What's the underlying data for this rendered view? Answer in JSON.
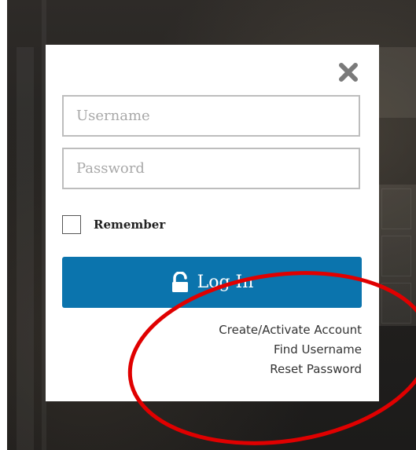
{
  "login_modal": {
    "close_icon": "close-x-icon",
    "username": {
      "placeholder": "Username",
      "value": ""
    },
    "password": {
      "placeholder": "Password",
      "value": ""
    },
    "remember_label": "Remember",
    "remember_checked": false,
    "login_button": {
      "label": "Log In",
      "icon": "unlock-icon"
    },
    "links": {
      "create_account": "Create/Activate Account",
      "find_username": "Find Username",
      "reset_password": "Reset Password"
    }
  },
  "colors": {
    "button_blue": "#0b74ad",
    "annotation_red": "#e00000",
    "backdrop_dark": "#262320"
  }
}
